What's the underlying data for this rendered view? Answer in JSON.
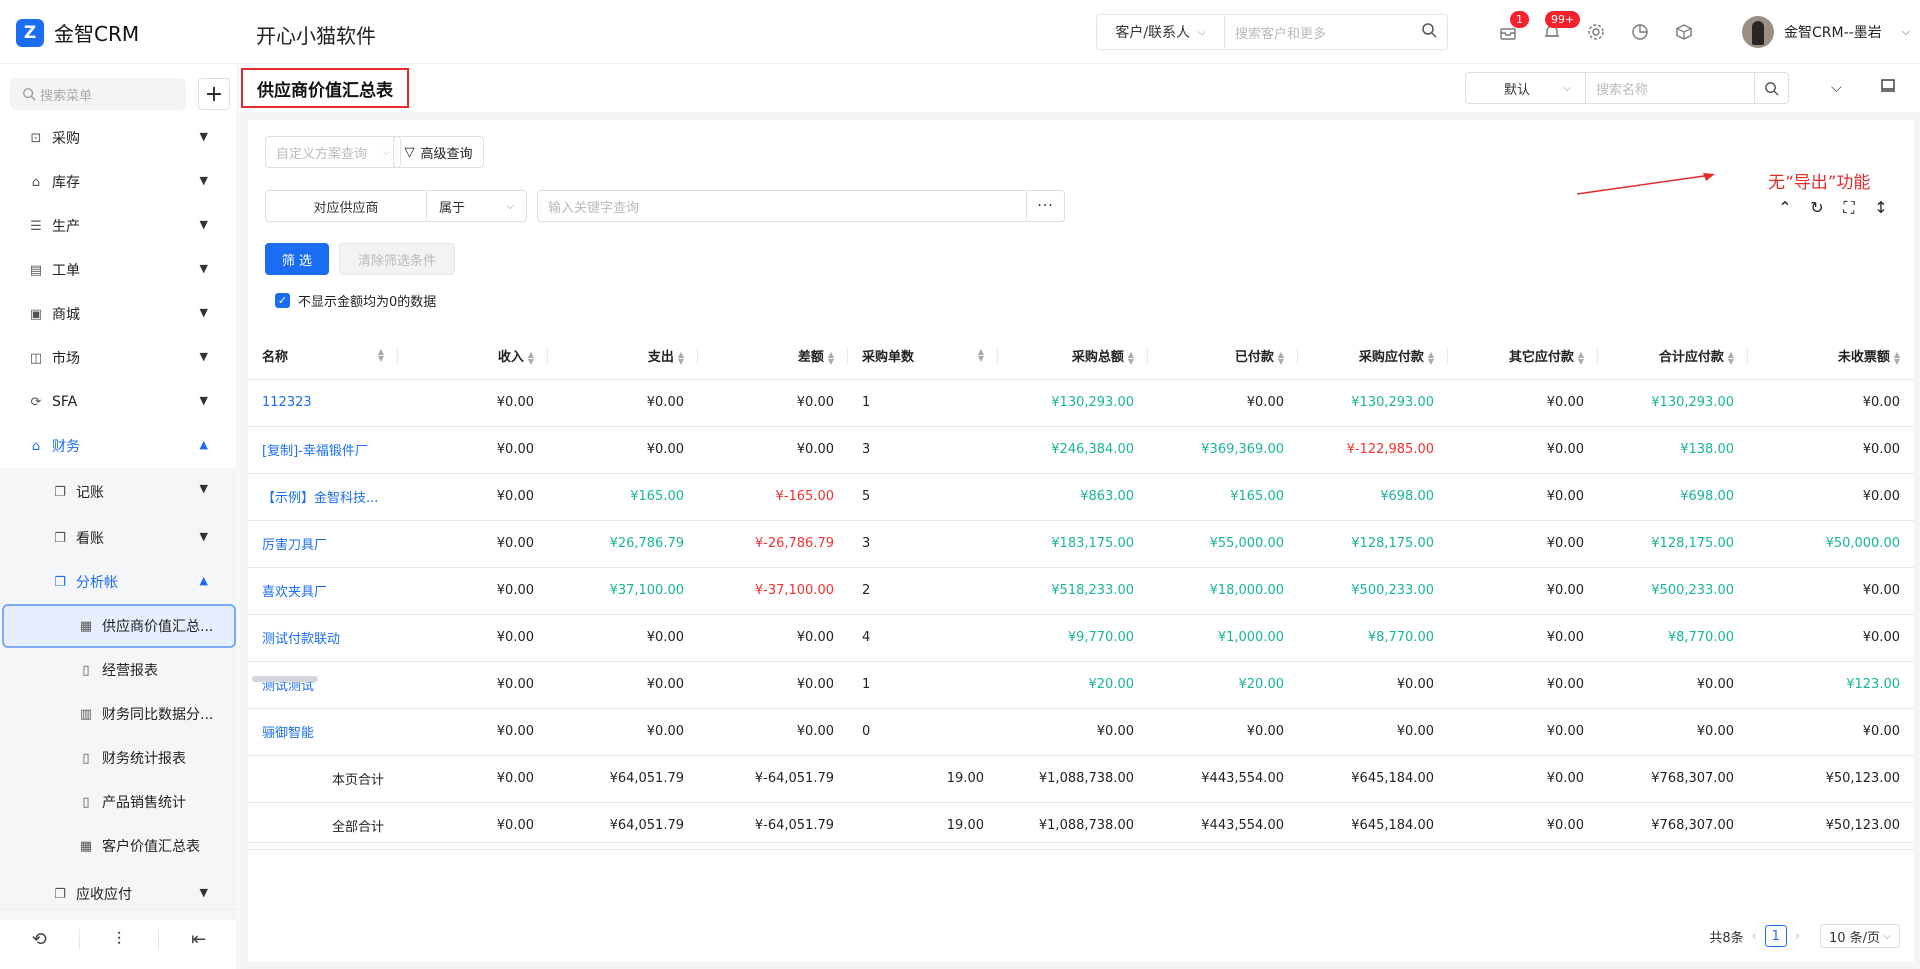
{
  "header": {
    "logo_letter": "Z",
    "logo_text": "金智CRM",
    "company": "开心小猫软件",
    "search_scope": "客户/联系人",
    "search_placeholder": "搜索客户和更多",
    "msg_badge": "1",
    "notice_badge": "99+",
    "user_name": "金智CRM--墨岩"
  },
  "sidebar": {
    "search_placeholder": "搜索菜单",
    "items": [
      {
        "label": "采购",
        "icon": "cart-icon"
      },
      {
        "label": "库存",
        "icon": "warehouse-icon"
      },
      {
        "label": "生产",
        "icon": "production-icon"
      },
      {
        "label": "工单",
        "icon": "ticket-icon"
      },
      {
        "label": "商城",
        "icon": "shop-icon"
      },
      {
        "label": "市场",
        "icon": "market-icon"
      },
      {
        "label": "SFA",
        "icon": "sfa-icon"
      },
      {
        "label": "财务",
        "icon": "finance-icon"
      }
    ],
    "finance_sub": [
      {
        "label": "记账"
      },
      {
        "label": "看账"
      },
      {
        "label": "分析帐"
      }
    ],
    "analysis_sub": [
      {
        "label": "供应商价值汇总..."
      },
      {
        "label": "经营报表"
      },
      {
        "label": "财务同比数据分..."
      },
      {
        "label": "财务统计报表"
      },
      {
        "label": "产品销售统计"
      },
      {
        "label": "客户价值汇总表"
      }
    ],
    "last_sub": {
      "label": "应收应付"
    }
  },
  "page": {
    "title": "供应商价值汇总表",
    "view_select": "默认",
    "name_search_placeholder": "搜索名称",
    "annotation": "无“导出”功能"
  },
  "filter": {
    "custom_plan_placeholder": "自定义方案查询",
    "advanced": "高级查询",
    "field": "对应供应商",
    "operator": "属于",
    "keyword_placeholder": "输入关键字查询",
    "more": "···",
    "filter_btn": "筛 选",
    "clear_btn": "清除筛选条件",
    "hide_zero_label": "不显示金额均为0的数据"
  },
  "table": {
    "columns": [
      "名称",
      "收入",
      "支出",
      "差额",
      "采购单数",
      "采购总额",
      "已付款",
      "采购应付款",
      "其它应付款",
      "合计应付款",
      "未收票额"
    ],
    "rows": [
      [
        "112323",
        "¥0.00",
        "¥0.00",
        "¥0.00",
        "1",
        "¥130,293.00",
        "¥0.00",
        "¥130,293.00",
        "¥0.00",
        "¥130,293.00",
        "¥0.00"
      ],
      [
        "[复制]-幸福锻件厂",
        "¥0.00",
        "¥0.00",
        "¥0.00",
        "3",
        "¥246,384.00",
        "¥369,369.00",
        "¥-122,985.00",
        "¥0.00",
        "¥138.00",
        "¥0.00"
      ],
      [
        "【示例】金智科技...",
        "¥0.00",
        "¥165.00",
        "¥-165.00",
        "5",
        "¥863.00",
        "¥165.00",
        "¥698.00",
        "¥0.00",
        "¥698.00",
        "¥0.00"
      ],
      [
        "厉害刀具厂",
        "¥0.00",
        "¥26,786.79",
        "¥-26,786.79",
        "3",
        "¥183,175.00",
        "¥55,000.00",
        "¥128,175.00",
        "¥0.00",
        "¥128,175.00",
        "¥50,000.00"
      ],
      [
        "喜欢夹具厂",
        "¥0.00",
        "¥37,100.00",
        "¥-37,100.00",
        "2",
        "¥518,233.00",
        "¥18,000.00",
        "¥500,233.00",
        "¥0.00",
        "¥500,233.00",
        "¥0.00"
      ],
      [
        "测试付款联动",
        "¥0.00",
        "¥0.00",
        "¥0.00",
        "4",
        "¥9,770.00",
        "¥1,000.00",
        "¥8,770.00",
        "¥0.00",
        "¥8,770.00",
        "¥0.00"
      ],
      [
        "测试测试",
        "¥0.00",
        "¥0.00",
        "¥0.00",
        "1",
        "¥20.00",
        "¥20.00",
        "¥0.00",
        "¥0.00",
        "¥0.00",
        "¥123.00"
      ],
      [
        "骊御智能",
        "¥0.00",
        "¥0.00",
        "¥0.00",
        "0",
        "¥0.00",
        "¥0.00",
        "¥0.00",
        "¥0.00",
        "¥0.00",
        "¥0.00"
      ]
    ],
    "page_total": [
      "本页合计",
      "¥0.00",
      "¥64,051.79",
      "¥-64,051.79",
      "19.00",
      "¥1,088,738.00",
      "¥443,554.00",
      "¥645,184.00",
      "¥0.00",
      "¥768,307.00",
      "¥50,123.00"
    ],
    "all_total": [
      "全部合计",
      "¥0.00",
      "¥64,051.79",
      "¥-64,051.79",
      "19.00",
      "¥1,088,738.00",
      "¥443,554.00",
      "¥645,184.00",
      "¥0.00",
      "¥768,307.00",
      "¥50,123.00"
    ]
  },
  "pager": {
    "total": "共8条",
    "current": "1",
    "page_size": "10 条/页"
  },
  "colors": {
    "accent": "#1b6ef3",
    "positive": "#19b59a",
    "negative": "#f0312f",
    "annotation": "#e12d2d"
  }
}
